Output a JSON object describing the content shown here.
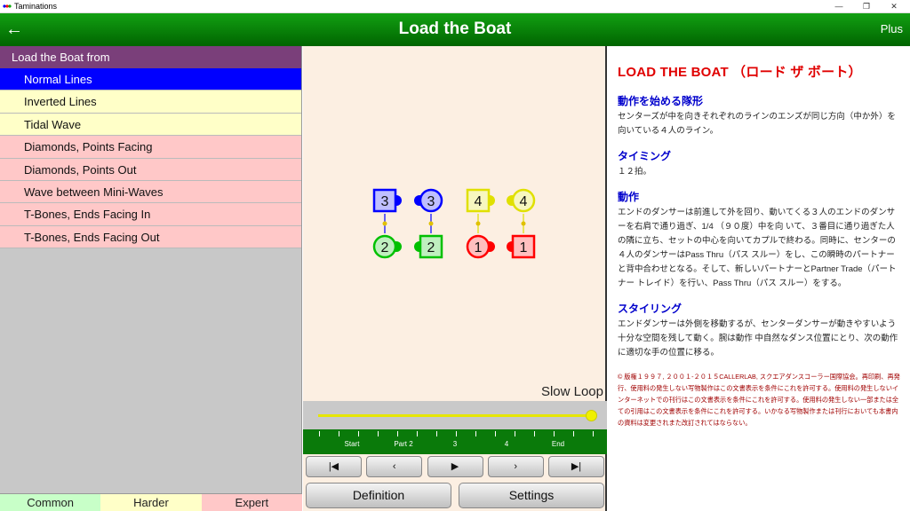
{
  "window": {
    "title": "Taminations",
    "minimize": "—",
    "maximize": "❐",
    "close": "✕"
  },
  "appbar": {
    "title": "Load the Boat",
    "back": "←",
    "plus": "Plus"
  },
  "list": {
    "header": "Load the Boat from",
    "items": [
      {
        "label": "Normal Lines",
        "style": "selected"
      },
      {
        "label": "Inverted Lines",
        "style": "yellow"
      },
      {
        "label": "Tidal Wave",
        "style": "yellow"
      },
      {
        "label": "Diamonds, Points Facing",
        "style": "pink"
      },
      {
        "label": "Diamonds, Points Out",
        "style": "pink"
      },
      {
        "label": "Wave between Mini-Waves",
        "style": "pink"
      },
      {
        "label": "T-Bones, Ends Facing In",
        "style": "pink"
      },
      {
        "label": "T-Bones, Ends Facing Out",
        "style": "pink"
      }
    ]
  },
  "levels": [
    {
      "label": "Common",
      "color": "#c8ffc8"
    },
    {
      "label": "Harder",
      "color": "#ffffc8"
    },
    {
      "label": "Expert",
      "color": "#ffc8c8"
    }
  ],
  "animation": {
    "slow_loop": "Slow Loop",
    "progress": 1.0,
    "tick_labels": [
      "Start",
      "Part 2",
      "3",
      "4",
      "End"
    ],
    "controls": [
      "|◀",
      "‹",
      "▶",
      "›",
      "▶|"
    ],
    "definition_button": "Definition",
    "settings_button": "Settings",
    "dancers": [
      {
        "number": "3",
        "shape": "square",
        "color": "#0000ff"
      },
      {
        "number": "3",
        "shape": "circle",
        "color": "#0000ff"
      },
      {
        "number": "4",
        "shape": "square",
        "color": "#e0e000"
      },
      {
        "number": "4",
        "shape": "circle",
        "color": "#e0e000"
      },
      {
        "number": "2",
        "shape": "circle",
        "color": "#00c000"
      },
      {
        "number": "2",
        "shape": "square",
        "color": "#00c000"
      },
      {
        "number": "1",
        "shape": "circle",
        "color": "#ff0000"
      },
      {
        "number": "1",
        "shape": "square",
        "color": "#ff0000"
      }
    ]
  },
  "definition": {
    "title": "LOAD THE BOAT （ロード ザ ボート）",
    "sections": [
      {
        "heading": "動作を始める隊形",
        "text": "センターズが中を向きそれぞれのラインのエンズが同じ方向（中か外）を向いている４人のライン。"
      },
      {
        "heading": "タイミング",
        "text": "１２拍。"
      },
      {
        "heading": "動作",
        "text": "エンドのダンサーは前進して外を回り、動いてくる３人のエンドのダンサーを右肩で通り過ぎ、1/4 （９０度）中を向 いて、３番目に通り過ぎた人の隣に立ち、セットの中心を向いてカプルで終わる。同時に、センターの４人のダンサーはPass Thru（パス スルー）をし、この瞬時のパートナーと背中合わせとなる。そして、新しいパートナーとPartner Trade（パートナー トレイド）を行い、Pass Thru（パス スルー）をする。"
      },
      {
        "heading": "スタイリング",
        "text": "エンドダンサーは外側を移動するが、センターダンサーが動きやすいよう十分な空間を残して動く。腕は動作 中自然なダンス位置にとり、次の動作に適切な手の位置に移る。"
      }
    ],
    "copyright": "© 版権１９９７, ２００１-２０１５CALLERLAB, スクエアダンスコーラー国際協会。再印刷、再発行、使用料の発生しない写物製作はこの文書表示を条件にこれを許可する。使用料の発生しないインターネットでの刊行はこの文書表示を条件にこれを許可する。使用料の発生しない一部または全ての引用はこの文書表示を条件にこれを許可する。いかなる写物製作または刊行においても本書内の資料は変更されまた改訂されてはならない。"
  }
}
